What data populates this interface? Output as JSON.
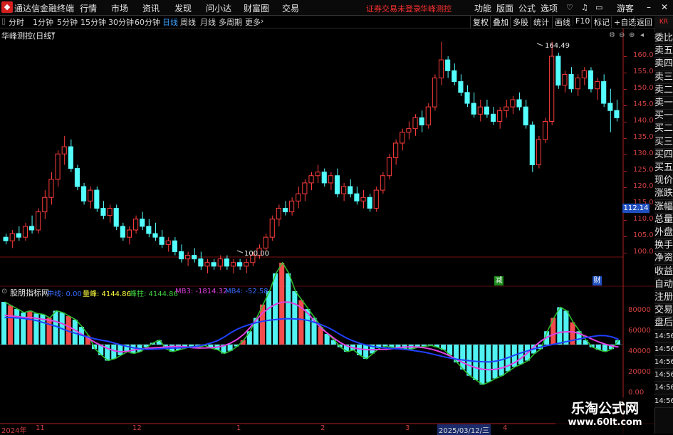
{
  "app": {
    "title": "通达信金融终端",
    "logo": "Logo"
  },
  "menu": [
    "行情",
    "市场",
    "资讯",
    "发现",
    "问小达",
    "财富圈",
    "交易"
  ],
  "menu_status": [
    "证券交易未登录",
    "华峰测控"
  ],
  "menu_right": [
    "功能",
    "版面",
    "公式",
    "选项",
    "游客"
  ],
  "periods": [
    "分时",
    "1分钟",
    "5分钟",
    "15分钟",
    "30分钟",
    "60分钟",
    "日线",
    "周线",
    "月线",
    "多周期",
    "更多"
  ],
  "active_period": "日线",
  "toolbar": [
    "复权",
    "叠加",
    "多股",
    "统计",
    "画线",
    "F10",
    "标记",
    "+自选",
    "返回"
  ],
  "chart_title": "华峰测控(日线)",
  "price_ticks": [
    "160.0",
    "155.0",
    "150.0",
    "145.0",
    "140.0",
    "135.0",
    "130.0",
    "125.0",
    "120.0",
    "115.0",
    "110.0",
    "105.0",
    "100.0"
  ],
  "price_current": "112.14",
  "price_high_label": "164.49",
  "price_low_label": "100.00",
  "badge_jian": "减",
  "badge_cai": "财",
  "indicator": {
    "name": "股朋指标网",
    "items": [
      {
        "label": "中线: 0.00",
        "color": "#3a6bff"
      },
      {
        "label": "量峰: 4144.86",
        "color": "#ffff40"
      },
      {
        "label": "峰柱: 4144.86",
        "color": "#40d040"
      },
      {
        "label": "MB3: -1814.32",
        "color": "#e040e0"
      },
      {
        "label": "MB4: -52.58",
        "color": "#3a6bff"
      }
    ]
  },
  "ind_ticks": [
    "80000",
    "60000",
    "40000",
    "20000",
    "0.00"
  ],
  "xaxis": [
    {
      "label": "2024年"
    },
    {
      "label": "11"
    },
    {
      "label": "12"
    },
    {
      "label": "1"
    },
    {
      "label": "2"
    },
    {
      "label": "3"
    },
    {
      "label": "2025/03/12/三"
    },
    {
      "label": "4"
    }
  ],
  "right_panel": [
    "委比",
    "卖五",
    "卖四",
    "卖三",
    "卖二",
    "卖一",
    "买一",
    "买二",
    "买三",
    "买四",
    "买五",
    "现价",
    "涨跌",
    "涨幅",
    "总量",
    "外盘",
    "换手",
    "净资",
    "收益",
    "自动",
    "注册",
    "交易",
    "盘后",
    "14:56",
    "14:56",
    "14:56",
    "14:56",
    "14:56",
    "14:56"
  ],
  "kr_badge": "KR",
  "watermark": {
    "title": "乐淘公式网",
    "url": "www.60lt.com"
  },
  "colors": {
    "up": "#ff3c3c",
    "down": "#54ffff",
    "grid": "#7a1010",
    "axis": "#b02020"
  },
  "chart_data": {
    "type": "candlestick",
    "y_range": [
      98,
      166
    ],
    "candles": [
      [
        110,
        111,
        108,
        109
      ],
      [
        109,
        112,
        107,
        111
      ],
      [
        111,
        113,
        109,
        110
      ],
      [
        110,
        114,
        109,
        113
      ],
      [
        113,
        116,
        111,
        112
      ],
      [
        112,
        118,
        111,
        117
      ],
      [
        117,
        123,
        115,
        121
      ],
      [
        121,
        128,
        119,
        126
      ],
      [
        126,
        134,
        124,
        133
      ],
      [
        133,
        138,
        130,
        135
      ],
      [
        135,
        137,
        128,
        129
      ],
      [
        129,
        130,
        123,
        124
      ],
      [
        124,
        125,
        119,
        120
      ],
      [
        120,
        124,
        118,
        123
      ],
      [
        123,
        124,
        117,
        118
      ],
      [
        118,
        120,
        115,
        116
      ],
      [
        116,
        119,
        114,
        118
      ],
      [
        118,
        119,
        112,
        113
      ],
      [
        113,
        114,
        109,
        110
      ],
      [
        110,
        113,
        108,
        112
      ],
      [
        112,
        116,
        111,
        115
      ],
      [
        115,
        117,
        112,
        113
      ],
      [
        113,
        115,
        110,
        111
      ],
      [
        111,
        114,
        109,
        110
      ],
      [
        110,
        112,
        107,
        108
      ],
      [
        108,
        110,
        106,
        109
      ],
      [
        109,
        110,
        105,
        106
      ],
      [
        106,
        108,
        103,
        104
      ],
      [
        104,
        106,
        102,
        105
      ],
      [
        105,
        107,
        103,
        104
      ],
      [
        104,
        106,
        101,
        102
      ],
      [
        102,
        104,
        100,
        103
      ],
      [
        103,
        104,
        101,
        102
      ],
      [
        102,
        105,
        101,
        104
      ],
      [
        104,
        105,
        101,
        102
      ],
      [
        102,
        104,
        100,
        103
      ],
      [
        103,
        104,
        101,
        102
      ],
      [
        102,
        104,
        100,
        103
      ],
      [
        103,
        106,
        102,
        105
      ],
      [
        105,
        108,
        104,
        107
      ],
      [
        107,
        111,
        106,
        110
      ],
      [
        110,
        116,
        109,
        115
      ],
      [
        115,
        119,
        113,
        118
      ],
      [
        118,
        120,
        116,
        117
      ],
      [
        117,
        121,
        116,
        120
      ],
      [
        120,
        124,
        118,
        122
      ],
      [
        122,
        126,
        120,
        125
      ],
      [
        125,
        128,
        123,
        127
      ],
      [
        127,
        130,
        125,
        128
      ],
      [
        128,
        129,
        124,
        125
      ],
      [
        125,
        128,
        123,
        127
      ],
      [
        127,
        129,
        121,
        122
      ],
      [
        122,
        125,
        120,
        124
      ],
      [
        124,
        126,
        121,
        122
      ],
      [
        122,
        124,
        119,
        120
      ],
      [
        120,
        123,
        118,
        121
      ],
      [
        121,
        122,
        117,
        118
      ],
      [
        118,
        124,
        117,
        123
      ],
      [
        123,
        128,
        122,
        127
      ],
      [
        127,
        133,
        126,
        132
      ],
      [
        132,
        137,
        130,
        136
      ],
      [
        136,
        140,
        134,
        139
      ],
      [
        139,
        142,
        137,
        140
      ],
      [
        140,
        144,
        138,
        143
      ],
      [
        143,
        145,
        139,
        141
      ],
      [
        141,
        147,
        140,
        146
      ],
      [
        146,
        155,
        145,
        154
      ],
      [
        154,
        164,
        152,
        159
      ],
      [
        159,
        160,
        154,
        156
      ],
      [
        156,
        158,
        152,
        153
      ],
      [
        153,
        155,
        149,
        150
      ],
      [
        150,
        152,
        146,
        147
      ],
      [
        147,
        150,
        143,
        144
      ],
      [
        144,
        148,
        142,
        146
      ],
      [
        146,
        148,
        143,
        144
      ],
      [
        144,
        146,
        141,
        142
      ],
      [
        142,
        146,
        140,
        145
      ],
      [
        145,
        148,
        143,
        146
      ],
      [
        146,
        149,
        144,
        148
      ],
      [
        148,
        150,
        145,
        146
      ],
      [
        146,
        148,
        140,
        141
      ],
      [
        141,
        142,
        128,
        130
      ],
      [
        130,
        138,
        129,
        137
      ],
      [
        137,
        143,
        136,
        142
      ],
      [
        142,
        164,
        141,
        160
      ],
      [
        160,
        161,
        151,
        152
      ],
      [
        152,
        156,
        150,
        155
      ],
      [
        155,
        157,
        150,
        151
      ],
      [
        151,
        155,
        149,
        154
      ],
      [
        154,
        157,
        152,
        156
      ],
      [
        156,
        157,
        150,
        151
      ],
      [
        151,
        154,
        148,
        153
      ],
      [
        153,
        155,
        146,
        147
      ],
      [
        147,
        151,
        139,
        145
      ],
      [
        145,
        148,
        142,
        143
      ]
    ],
    "indicator_bars": [
      48000,
      44000,
      40000,
      36000,
      38000,
      35000,
      34000,
      30000,
      38000,
      36000,
      32000,
      28000,
      20000,
      10000,
      -5000,
      -12000,
      -18000,
      -16000,
      -12000,
      -8000,
      -10000,
      -8000,
      -3000,
      2000,
      5000,
      -5000,
      -8000,
      -6000,
      -4000,
      -2000,
      -3000,
      -1000,
      -4000,
      -6000,
      -10000,
      -7000,
      -2000,
      5000,
      15000,
      30000,
      45000,
      60000,
      80000,
      92000,
      80000,
      60000,
      50000,
      40000,
      30000,
      20000,
      12000,
      5000,
      -3000,
      -8000,
      -6000,
      -12000,
      -16000,
      -10000,
      -4000,
      -2000,
      -3000,
      -4000,
      -5000,
      -5000,
      -3000,
      -2000,
      -1000,
      -3000,
      -6000,
      -12000,
      -20000,
      -28000,
      -35000,
      -40000,
      -45000,
      -42000,
      -38000,
      -35000,
      -30000,
      -25000,
      -22000,
      -18000,
      -10000,
      -5000,
      15000,
      30000,
      42000,
      38000,
      25000,
      15000,
      5000,
      -3000,
      -6000,
      -8000,
      -5000,
      5000
    ]
  }
}
